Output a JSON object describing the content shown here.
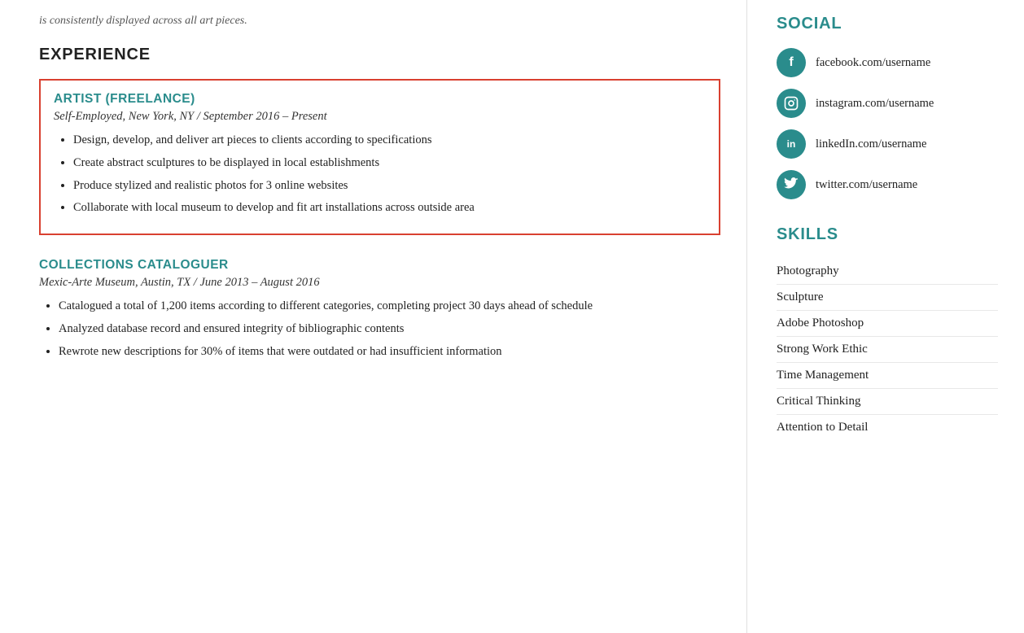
{
  "left": {
    "top_note": "is consistently displayed across all art pieces.",
    "experience_title": "EXPERIENCE",
    "jobs": [
      {
        "id": "artist-freelance",
        "highlighted": true,
        "title": "ARTIST (FREELANCE)",
        "subtitle": "Self-Employed, New York, NY  /  September 2016 – Present",
        "bullets": [
          "Design, develop, and deliver art pieces to clients according to specifications",
          "Create abstract sculptures to be displayed in local establishments",
          "Produce stylized and realistic photos for 3 online websites",
          "Collaborate with local museum to develop and fit art installations across outside area"
        ]
      },
      {
        "id": "collections-cataloguer",
        "highlighted": false,
        "title": "COLLECTIONS CATALOGUER",
        "subtitle": "Mexic-Arte Museum, Austin, TX  /  June 2013 – August 2016",
        "bullets": [
          "Catalogued a total of 1,200 items according to different categories, completing project 30 days ahead of schedule",
          "Analyzed database record and ensured integrity of bibliographic contents",
          "Rewrote new descriptions for 30% of items that were outdated or had insufficient information"
        ]
      }
    ]
  },
  "right": {
    "social_title": "SOCIAL",
    "social_items": [
      {
        "id": "facebook",
        "icon": "f",
        "label": "facebook.com/username"
      },
      {
        "id": "instagram",
        "icon": "◎",
        "label": "instagram.com/username"
      },
      {
        "id": "linkedin",
        "icon": "in",
        "label": "linkedIn.com/username"
      },
      {
        "id": "twitter",
        "icon": "🐦",
        "label": "twitter.com/username"
      }
    ],
    "skills_title": "SKILLS",
    "skills": [
      "Photography",
      "Sculpture",
      "Adobe Photoshop",
      "Strong Work Ethic",
      "Time Management",
      "Critical Thinking",
      "Attention to Detail"
    ]
  }
}
